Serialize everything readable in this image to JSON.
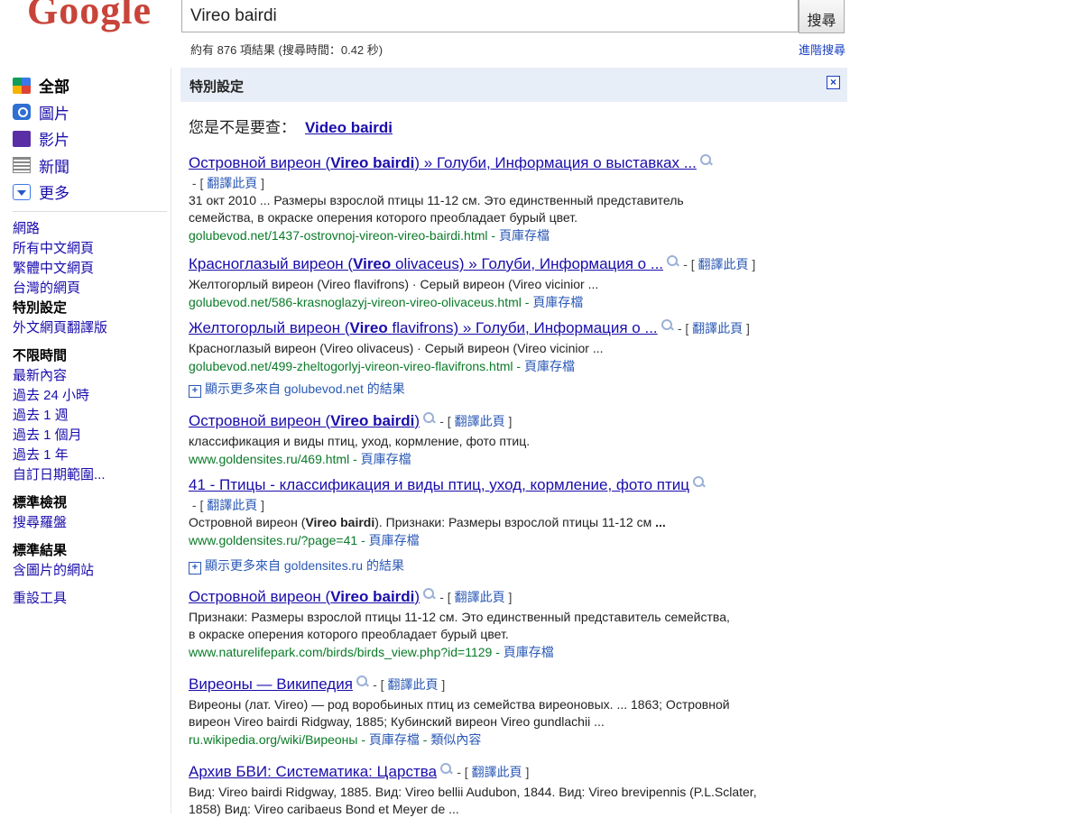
{
  "logo_text": "Google",
  "search": {
    "query": "Vireo bairdi",
    "button": "搜尋"
  },
  "stats": "約有 876 項結果 (搜尋時間：0.42 秒)",
  "advanced_link": "進階搜尋",
  "nav": [
    {
      "label": "全部",
      "icon": "all-icon"
    },
    {
      "label": "圖片",
      "icon": "camera-icon"
    },
    {
      "label": "影片",
      "icon": "video-icon"
    },
    {
      "label": "新聞",
      "icon": "news-icon"
    },
    {
      "label": "更多",
      "icon": "dropdown-icon"
    }
  ],
  "filters": {
    "lang": [
      "網路",
      "所有中文網頁",
      "繁體中文網頁",
      "台灣的網頁",
      "特別設定",
      "外文網頁翻譯版"
    ],
    "time_header": "不限時間",
    "time": [
      "最新內容",
      "過去 24 小時",
      "過去 1 週",
      "過去 1 個月",
      "過去 1 年",
      "自訂日期範圍..."
    ],
    "view_header": "標準檢視",
    "view": [
      "搜尋羅盤"
    ],
    "result_header": "標準結果",
    "result": [
      "含圖片的網站"
    ],
    "reset": "重設工具"
  },
  "special_bar": "特別設定",
  "did_you_mean": {
    "prefix": "您是不是要查：",
    "suggestion": "Video bairdi"
  },
  "translate_label": "翻譯此頁",
  "cache_label": "頁庫存檔",
  "similar_label": "類似內容",
  "results": [
    {
      "t1": "Островной виреон (",
      "tb": "Vireo bairdi",
      "t2": ") » Голуби, Информация о выставках ...",
      "snippet": "31 окт 2010 ... Размеры взрослой птицы 11-12 см. Это единственный представитель семейства, в окраске оперения которого преобладает бурый цвет.",
      "url": "golubevod.net/1437-ostrovnoj-vireon-vireo-bairdi.html"
    },
    {
      "t1": "Красноглазый виреон (",
      "tb": "Vireo",
      "t2": " olivaceus) » Голуби, Информация о ...",
      "snippet": "Желтогорлый виреон (Vireo flavifrons) · Серый виреон (Vireo vicinior ...",
      "url": "golubevod.net/586-krasnoglazyj-vireon-vireo-olivaceus.html"
    },
    {
      "t1": "Желтогорлый виреон (",
      "tb": "Vireo",
      "t2": " flavifrons) » Голуби, Информация о ...",
      "snippet": "Красноглазый виреон (Vireo olivaceus) · Серый виреон (Vireo vicinior ...",
      "url": "golubevod.net/499-zheltogorlyj-vireon-vireo-flavifrons.html"
    },
    {
      "t1": "Островной виреон (",
      "tb": "Vireo bairdi",
      "t2": ")",
      "snippet": "классификация и виды птиц, уход, кормление, фото птиц.",
      "url": "www.goldensites.ru/469.html"
    },
    {
      "t1": "41 - Птицы - классификация и виды птиц, уход, кормление, фото птиц",
      "tb": "",
      "t2": "",
      "snippet": "Островной виреон (Vireo bairdi). Признаки: Размеры взрослой птицы 11-12 см ...",
      "url": "www.goldensites.ru/?page=41"
    },
    {
      "t1": "Островной виреон (",
      "tb": "Vireo bairdi",
      "t2": ")",
      "snippet": "Признаки: Размеры взрослой птицы 11-12 см. Это единственный представитель семейства, в окраске оперения которого преобладает бурый цвет.",
      "url": "www.naturelifepark.com/birds/birds_view.php?id=1129"
    },
    {
      "t1": "Виреоны — Википедия",
      "tb": "",
      "t2": "",
      "snippet": "Виреоны (лат. Vireo) — род воробьиных птиц из семейства виреоновых. ... 1863; Островной виреон Vireo bairdi Ridgway, 1885; Кубинский виреон Vireo gundlachii ...",
      "url": "ru.wikipedia.org/wiki/Виреоны"
    },
    {
      "t1": "Архив БВИ: Систематика: Царства",
      "tb": "",
      "t2": "",
      "snippet": "Вид: Vireo bairdi Ridgway, 1885. Вид: Vireo bellii Audubon, 1844. Вид: Vireo brevipennis (P.L.Sclater, 1858) Вид: Vireo caribaeus Bond et Meyer de ...",
      "url": ""
    }
  ],
  "more_from": [
    "顯示更多來自 golubevod.net 的結果",
    "顯示更多來自 goldensites.ru 的結果"
  ]
}
